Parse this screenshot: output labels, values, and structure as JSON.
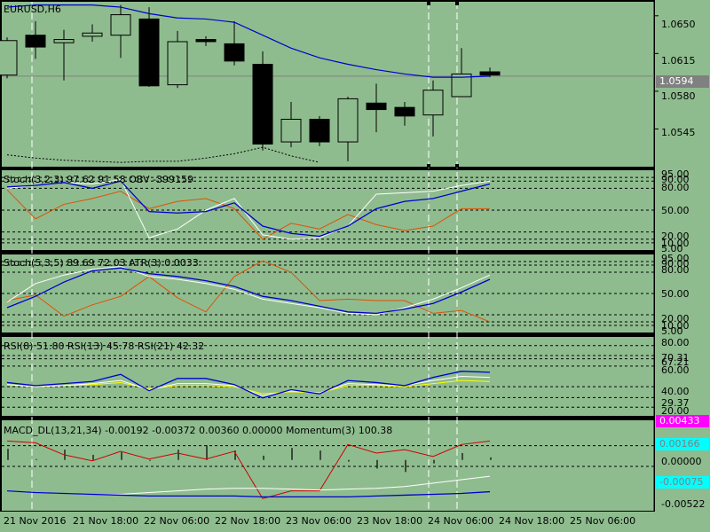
{
  "symbol_title": "EURUSD,H6",
  "colors": {
    "background": "#000000",
    "pane": "#8fbc8f",
    "bull_candle": "#ffffff",
    "bear_candle": "#000000",
    "ma_line": "#0000cd",
    "signal_line": "#ffffff",
    "orange_line": "#e05000",
    "red_line": "#cc0000",
    "yellow_line": "#ffff00",
    "macd_box": "#ff00ff",
    "value_box": "#00ffff"
  },
  "main": {
    "price_axis": [
      "1.0650",
      "1.0615",
      "1.0580",
      "1.0545"
    ],
    "current_price": "1.0594",
    "candles": [
      {
        "o": 1.0595,
        "h": 1.063,
        "l": 1.0592,
        "c": 1.0627
      },
      {
        "o": 1.0632,
        "h": 1.0645,
        "l": 1.061,
        "c": 1.0621
      },
      {
        "o": 1.0625,
        "h": 1.0637,
        "l": 1.059,
        "c": 1.0628
      },
      {
        "o": 1.0631,
        "h": 1.0642,
        "l": 1.0626,
        "c": 1.0634
      },
      {
        "o": 1.0632,
        "h": 1.066,
        "l": 1.0611,
        "c": 1.0651
      },
      {
        "o": 1.0647,
        "h": 1.0658,
        "l": 1.0584,
        "c": 1.0585
      },
      {
        "o": 1.0586,
        "h": 1.0636,
        "l": 1.0583,
        "c": 1.0626
      },
      {
        "o": 1.0628,
        "h": 1.0631,
        "l": 1.0622,
        "c": 1.0626
      },
      {
        "o": 1.0624,
        "h": 1.0645,
        "l": 1.0604,
        "c": 1.0608
      },
      {
        "o": 1.0605,
        "h": 1.0617,
        "l": 1.0525,
        "c": 1.0531
      },
      {
        "o": 1.0533,
        "h": 1.057,
        "l": 1.0528,
        "c": 1.0554
      },
      {
        "o": 1.0554,
        "h": 1.0557,
        "l": 1.0529,
        "c": 1.0533
      },
      {
        "o": 1.0533,
        "h": 1.0575,
        "l": 1.0515,
        "c": 1.0573
      },
      {
        "o": 1.0569,
        "h": 1.0587,
        "l": 1.0542,
        "c": 1.0563
      },
      {
        "o": 1.0565,
        "h": 1.057,
        "l": 1.0548,
        "c": 1.0557
      },
      {
        "o": 1.0558,
        "h": 1.059,
        "l": 1.0538,
        "c": 1.0581
      },
      {
        "o": 1.0575,
        "h": 1.062,
        "l": 1.0575,
        "c": 1.0596
      },
      {
        "o": 1.0598,
        "h": 1.0602,
        "l": 1.0593,
        "c": 1.0595
      }
    ],
    "ma": [
      1.0658,
      1.066,
      1.066,
      1.066,
      1.0658,
      1.0652,
      1.0648,
      1.0647,
      1.0644,
      1.0632,
      1.062,
      1.0611,
      1.0605,
      1.06,
      1.0596,
      1.0593,
      1.0593,
      1.0594
    ]
  },
  "stoch1": {
    "label": "Stoch(3,2,3) 97.62 91.58 OBV -399159",
    "levels": [
      "80.00",
      "50.00",
      "20.00"
    ],
    "edge_labels": [
      "95.00",
      "90.00",
      "10.00",
      "5.00"
    ],
    "main": [
      82,
      84,
      88,
      80,
      90,
      48,
      46,
      48,
      60,
      28,
      18,
      14,
      28,
      52,
      62,
      66,
      76,
      86
    ],
    "signal": [
      80,
      84,
      88,
      86,
      92,
      12,
      24,
      50,
      66,
      16,
      10,
      12,
      28,
      72,
      74,
      76,
      84,
      90
    ],
    "orange": [
      78,
      38,
      58,
      66,
      76,
      52,
      62,
      66,
      52,
      10,
      32,
      24,
      44,
      30,
      22,
      28,
      52,
      52
    ]
  },
  "stoch2": {
    "label": "Stoch(5,3,5) 89.69 72.03 ATR(3) 0.0033",
    "levels": [
      "80.00",
      "50.00",
      "20.00"
    ],
    "edge_labels": [
      "95.00",
      "90.00",
      "10.00",
      "5.00"
    ],
    "main": [
      30,
      46,
      66,
      82,
      86,
      78,
      74,
      68,
      60,
      46,
      40,
      32,
      24,
      22,
      28,
      36,
      52,
      70
    ],
    "signal": [
      38,
      64,
      76,
      84,
      88,
      74,
      70,
      64,
      56,
      42,
      36,
      30,
      22,
      20,
      30,
      42,
      58,
      76
    ],
    "orange": [
      40,
      48,
      18,
      34,
      46,
      74,
      44,
      24,
      74,
      96,
      80,
      40,
      42,
      40,
      40,
      22,
      26,
      10
    ]
  },
  "rsi": {
    "label": "RSI(8) 51.80 RSI(13) 45.78 RSI(21) 42.32",
    "levels": [
      "80.00",
      "67.21",
      "60.00",
      "40.00",
      "29.37",
      "20.00"
    ],
    "axis_label_top": "70.31",
    "rsi8": [
      44,
      41,
      43,
      45,
      52,
      36,
      48,
      48,
      42,
      29,
      37,
      33,
      46,
      44,
      41,
      49,
      55,
      54
    ],
    "rsi13": [
      42,
      40,
      41,
      43,
      46,
      37,
      43,
      43,
      41,
      31,
      36,
      34,
      43,
      42,
      41,
      46,
      50,
      49
    ],
    "rsi21": [
      42,
      40,
      41,
      42,
      44,
      38,
      41,
      41,
      40,
      33,
      35,
      34,
      41,
      41,
      40,
      43,
      46,
      45
    ]
  },
  "macd": {
    "label": "MACD_DL(13,21,34) -0.00192 -0.00372 0.00360 0.00000 Momentum(3) 100.38",
    "axis_labels": [
      "0.00433",
      "0.00166",
      "0.00000",
      "-0.00075",
      "-0.00522"
    ],
    "histogram": [
      0.0013,
      0.0001,
      0.0012,
      0.0006,
      0.0009,
      -0.0001,
      0.0012,
      0.0017,
      0.0011,
      0.0005,
      0.0014,
      0.0011,
      -0.0002,
      -0.001,
      -0.0014,
      -0.0004,
      0.0008,
      0.0003
    ],
    "momentum": [
      0.0022,
      0.002,
      0.0006,
      -0.0001,
      0.001,
      0.0001,
      0.0008,
      0.0001,
      0.001,
      -0.0045,
      -0.0036,
      -0.0036,
      0.0018,
      0.0008,
      0.0012,
      0.0004,
      0.0018,
      0.0022
    ],
    "white_line": [
      -0.0036,
      -0.0038,
      -0.0039,
      -0.004,
      -0.004,
      -0.0038,
      -0.0036,
      -0.0034,
      -0.0033,
      -0.0033,
      -0.0034,
      -0.0035,
      -0.0034,
      -0.0033,
      -0.0031,
      -0.0027,
      -0.0023,
      -0.0019
    ],
    "blue_line": [
      -0.0036,
      -0.0038,
      -0.0039,
      -0.004,
      -0.0041,
      -0.0042,
      -0.0042,
      -0.0042,
      -0.0042,
      -0.0043,
      -0.0043,
      -0.0043,
      -0.0043,
      -0.0042,
      -0.0041,
      -0.004,
      -0.0039,
      -0.0037
    ]
  },
  "time_axis": [
    "21 Nov 2016",
    "21 Nov 18:00",
    "22 Nov 06:00",
    "22 Nov 18:00",
    "23 Nov 06:00",
    "23 Nov 18:00",
    "24 Nov 06:00",
    "24 Nov 18:00",
    "25 Nov 06:00"
  ]
}
